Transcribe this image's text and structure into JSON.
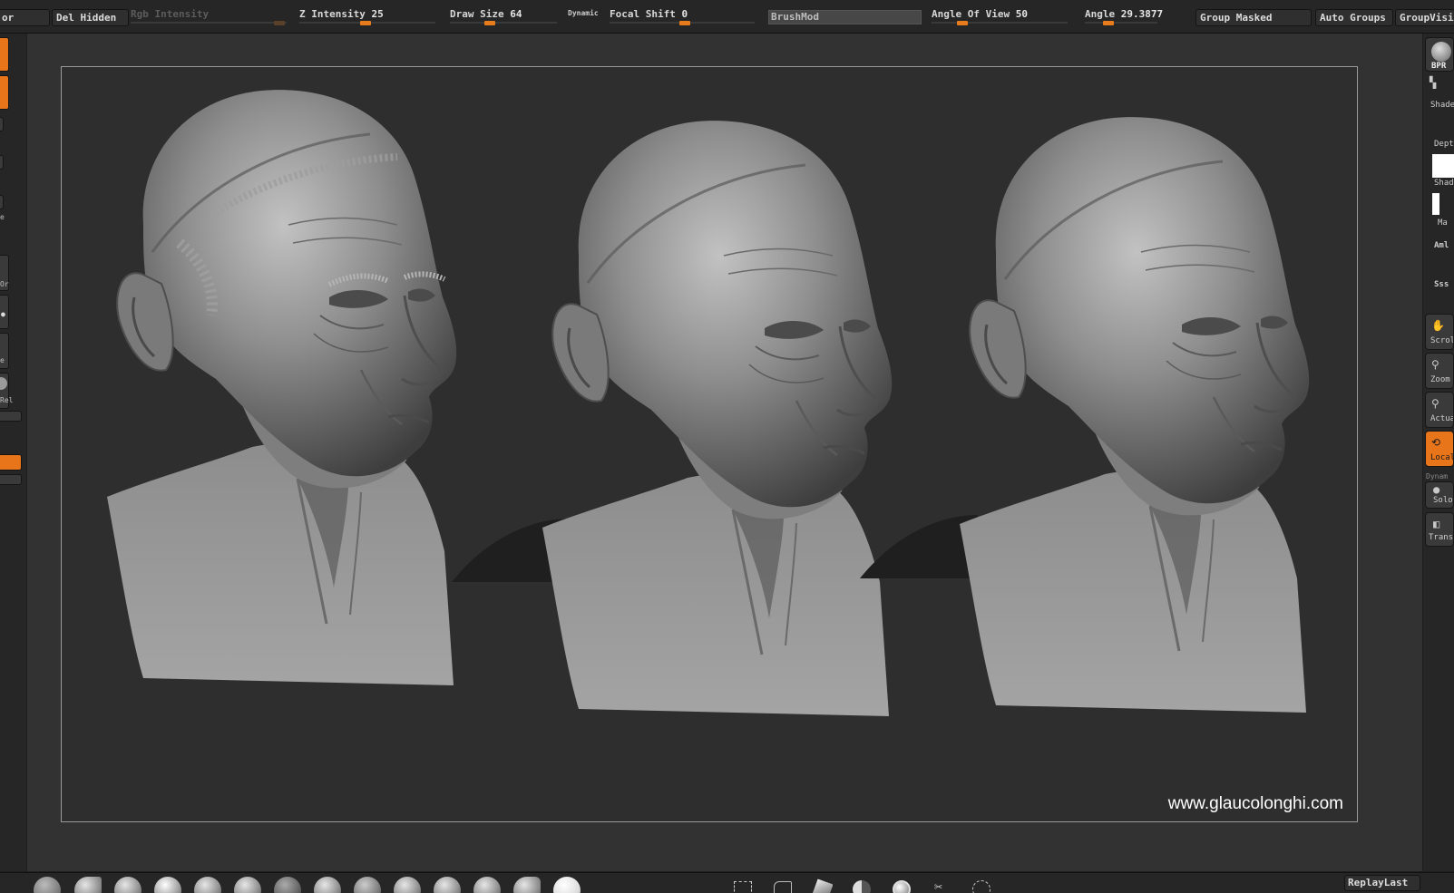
{
  "colors": {
    "accent": "#e8751a",
    "canvas_bg": "#2e2e2e",
    "ui_bg": "#262626",
    "sculpt_gray": "#8c8c8c"
  },
  "topbar": {
    "first_button_label": "or",
    "del_hidden_label": "Del Hidden",
    "rgb_intensity_label": "Rgb Intensity",
    "z_intensity_label": "Z Intensity",
    "z_intensity_value": "25",
    "draw_size_label": "Draw Size",
    "draw_size_value": "64",
    "dynamic_label": "Dynamic",
    "focal_shift_label": "Focal Shift",
    "focal_shift_value": "0",
    "brushmod_label": "BrushMod",
    "angle_of_view_label": "Angle Of View",
    "angle_of_view_value": "50",
    "angle_label": "Angle",
    "angle_value": "29.3877",
    "group_masked_label": "Group Masked",
    "auto_groups_label": "Auto Groups",
    "group_visible_label": "GroupVisibl"
  },
  "left_shelf": {
    "labels": [
      "e",
      "Or",
      "e",
      "Rel"
    ]
  },
  "right_shelf": {
    "bpr_label": "BPR",
    "shade_label": "Shade",
    "depth_label": "Dept",
    "shad_label": "Shad",
    "mat_label": "Ma",
    "amb_label": "Aml",
    "sss_label": "Sss",
    "scroll_label": "Scroll",
    "zoom_label": "Zoom",
    "actual_label": "Actua",
    "local_label": "Local",
    "dynamic_label": "Dynam",
    "solo_label": "Solo",
    "transp_label": "Transp"
  },
  "canvas": {
    "watermark": "www.glaucolonghi.com"
  },
  "bottombar": {
    "replay_last_label": "ReplayLast",
    "brush_icons": [
      "clay-brush-icon",
      "standard-brush-icon",
      "dam-standard-icon",
      "move-brush-icon",
      "inflate-brush-icon",
      "pinch-brush-icon",
      "spray-stroke-icon",
      "alpha-brush-icon",
      "smooth-brush-icon",
      "flatten-brush-icon",
      "trim-brush-icon",
      "polish-brush-icon",
      "slash-brush-icon",
      "matcap-sphere-icon"
    ],
    "tool_icons": [
      "select-rect-icon",
      "select-lasso-icon",
      "mask-pen-icon",
      "sphere-half-icon",
      "matcap-icon",
      "scissors-icon",
      "dashed-sphere-icon"
    ]
  }
}
